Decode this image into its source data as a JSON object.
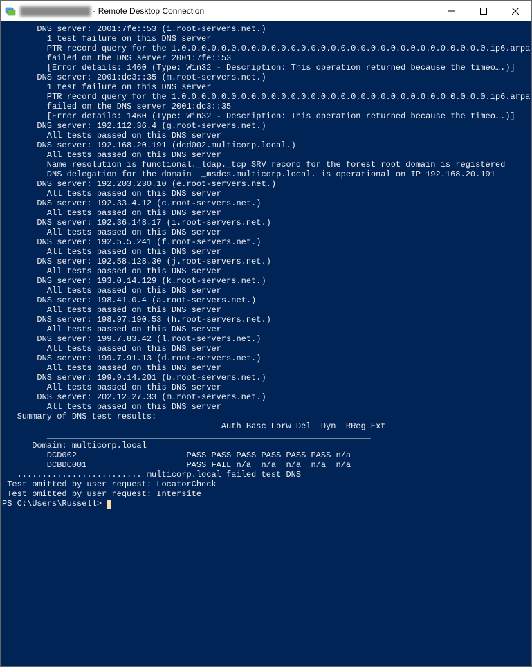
{
  "window": {
    "title_prefix": "████████████",
    "title_suffix": " - Remote Desktop Connection"
  },
  "terminal": {
    "blocks": [
      {
        "i": 1,
        "t": "DNS server: 2001:7fe::53 (i.root-servers.net.)"
      },
      {
        "i": 2,
        "t": "1 test failure on this DNS server"
      },
      {
        "i": 2,
        "t": "PTR record query for the 1.0.0.0.0.0.0.0.0.0.0.0.0.0.0.0.0.0.0.0.0.0.0.0.0.0.0.0.0.0.0.0.ip6.arpa"
      },
      {
        "i": 2,
        "t": "failed on the DNS server 2001:7fe::53"
      },
      {
        "i": 0,
        "t": ""
      },
      {
        "i": 2,
        "t": "[Error details: 1460 (Type: Win32 - Description: This operation returned because the timeo….)]"
      },
      {
        "i": 0,
        "t": ""
      },
      {
        "i": 0,
        "t": ""
      },
      {
        "i": 1,
        "t": "DNS server: 2001:dc3::35 (m.root-servers.net.)"
      },
      {
        "i": 2,
        "t": "1 test failure on this DNS server"
      },
      {
        "i": 2,
        "t": "PTR record query for the 1.0.0.0.0.0.0.0.0.0.0.0.0.0.0.0.0.0.0.0.0.0.0.0.0.0.0.0.0.0.0.0.ip6.arpa"
      },
      {
        "i": 2,
        "t": "failed on the DNS server 2001:dc3::35"
      },
      {
        "i": 0,
        "t": ""
      },
      {
        "i": 2,
        "t": "[Error details: 1460 (Type: Win32 - Description: This operation returned because the timeo….)]"
      },
      {
        "i": 0,
        "t": ""
      },
      {
        "i": 0,
        "t": ""
      },
      {
        "i": 1,
        "t": "DNS server: 192.112.36.4 (g.root-servers.net.)"
      },
      {
        "i": 2,
        "t": "All tests passed on this DNS server"
      },
      {
        "i": 0,
        "t": ""
      },
      {
        "i": 1,
        "t": "DNS server: 192.168.20.191 (dcd002.multicorp.local.)"
      },
      {
        "i": 2,
        "t": "All tests passed on this DNS server"
      },
      {
        "i": 2,
        "t": "Name resolution is functional._ldap._tcp SRV record for the forest root domain is registered"
      },
      {
        "i": 2,
        "t": "DNS delegation for the domain  _msdcs.multicorp.local. is operational on IP 192.168.20.191"
      },
      {
        "i": 0,
        "t": ""
      },
      {
        "i": 0,
        "t": ""
      },
      {
        "i": 1,
        "t": "DNS server: 192.203.230.10 (e.root-servers.net.)"
      },
      {
        "i": 2,
        "t": "All tests passed on this DNS server"
      },
      {
        "i": 0,
        "t": ""
      },
      {
        "i": 1,
        "t": "DNS server: 192.33.4.12 (c.root-servers.net.)"
      },
      {
        "i": 2,
        "t": "All tests passed on this DNS server"
      },
      {
        "i": 0,
        "t": ""
      },
      {
        "i": 1,
        "t": "DNS server: 192.36.148.17 (i.root-servers.net.)"
      },
      {
        "i": 2,
        "t": "All tests passed on this DNS server"
      },
      {
        "i": 0,
        "t": ""
      },
      {
        "i": 1,
        "t": "DNS server: 192.5.5.241 (f.root-servers.net.)"
      },
      {
        "i": 2,
        "t": "All tests passed on this DNS server"
      },
      {
        "i": 0,
        "t": ""
      },
      {
        "i": 1,
        "t": "DNS server: 192.58.128.30 (j.root-servers.net.)"
      },
      {
        "i": 2,
        "t": "All tests passed on this DNS server"
      },
      {
        "i": 0,
        "t": ""
      },
      {
        "i": 1,
        "t": "DNS server: 193.0.14.129 (k.root-servers.net.)"
      },
      {
        "i": 2,
        "t": "All tests passed on this DNS server"
      },
      {
        "i": 0,
        "t": ""
      },
      {
        "i": 1,
        "t": "DNS server: 198.41.0.4 (a.root-servers.net.)"
      },
      {
        "i": 2,
        "t": "All tests passed on this DNS server"
      },
      {
        "i": 0,
        "t": ""
      },
      {
        "i": 1,
        "t": "DNS server: 198.97.190.53 (h.root-servers.net.)"
      },
      {
        "i": 2,
        "t": "All tests passed on this DNS server"
      },
      {
        "i": 0,
        "t": ""
      },
      {
        "i": 1,
        "t": "DNS server: 199.7.83.42 (l.root-servers.net.)"
      },
      {
        "i": 2,
        "t": "All tests passed on this DNS server"
      },
      {
        "i": 0,
        "t": ""
      },
      {
        "i": 1,
        "t": "DNS server: 199.7.91.13 (d.root-servers.net.)"
      },
      {
        "i": 2,
        "t": "All tests passed on this DNS server"
      },
      {
        "i": 0,
        "t": ""
      },
      {
        "i": 1,
        "t": "DNS server: 199.9.14.201 (b.root-servers.net.)"
      },
      {
        "i": 2,
        "t": "All tests passed on this DNS server"
      },
      {
        "i": 0,
        "t": ""
      },
      {
        "i": 1,
        "t": "DNS server: 202.12.27.33 (m.root-servers.net.)"
      },
      {
        "i": 2,
        "t": "All tests passed on this DNS server"
      },
      {
        "i": 0,
        "t": ""
      },
      {
        "i": 3,
        "t": "Summary of DNS test results:"
      },
      {
        "i": 0,
        "t": ""
      },
      {
        "i": 0,
        "t": "                                            Auth Basc Forw Del  Dyn  RReg Ext"
      },
      {
        "i": 0,
        "t": "         _________________________________________________________________"
      },
      {
        "i": 0,
        "t": "      Domain: multicorp.local"
      },
      {
        "i": 0,
        "t": "         DCD002                      PASS PASS PASS PASS PASS PASS n/a"
      },
      {
        "i": 0,
        "t": "         DCBDC001                    PASS FAIL n/a  n/a  n/a  n/a  n/a"
      },
      {
        "i": 0,
        "t": ""
      },
      {
        "i": 0,
        "t": "   ......................... multicorp.local failed test DNS"
      },
      {
        "i": 1,
        "b": true,
        "t": "Test omitted by user request: LocatorCheck"
      },
      {
        "i": 1,
        "b": true,
        "t": "Test omitted by user request: Intersite"
      }
    ],
    "prompt": "PS C:\\Users\\Russell> "
  }
}
